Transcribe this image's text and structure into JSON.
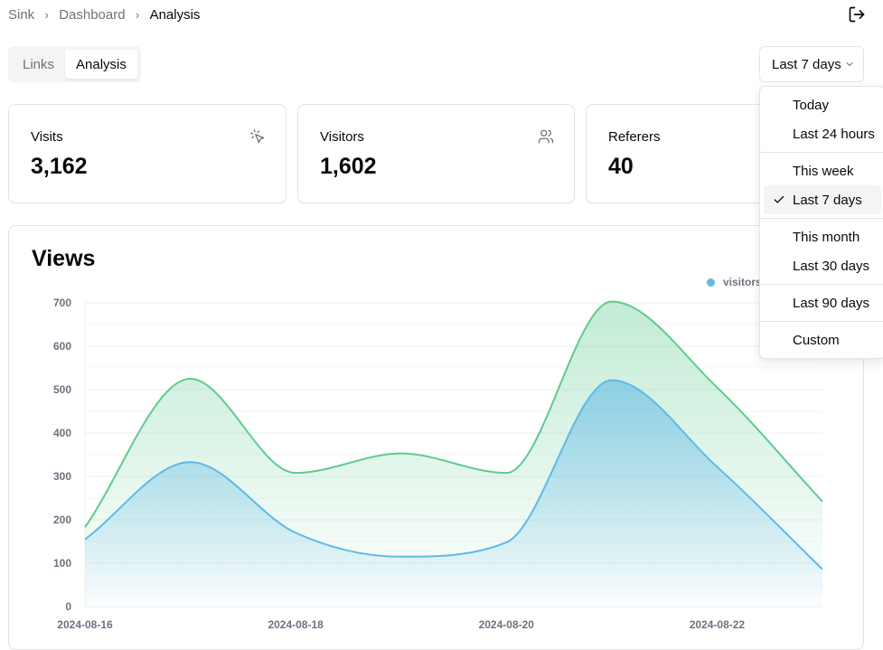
{
  "breadcrumb": [
    "Sink",
    "Dashboard",
    "Analysis"
  ],
  "icons": {
    "logout": "log-out-icon",
    "chevron": "chevron-down-icon",
    "check": "check-icon",
    "visits": "mouse-pointer-click-icon",
    "visitors": "users-icon"
  },
  "tabs": [
    {
      "label": "Links",
      "active": false
    },
    {
      "label": "Analysis",
      "active": true
    }
  ],
  "range": {
    "selected": "Last 7 days"
  },
  "stats": [
    {
      "label": "Visits",
      "value": "3,162"
    },
    {
      "label": "Visitors",
      "value": "1,602"
    },
    {
      "label": "Referers",
      "value": "40"
    }
  ],
  "views": {
    "title": "Views",
    "legend": [
      {
        "name": "visitors",
        "color": "#60b9e8"
      }
    ]
  },
  "dropdown": {
    "groups": [
      [
        {
          "label": "Today"
        },
        {
          "label": "Last 24 hours"
        }
      ],
      [
        {
          "label": "This week"
        },
        {
          "label": "Last 7 days",
          "selected": true
        }
      ],
      [
        {
          "label": "This month"
        },
        {
          "label": "Last 30 days"
        }
      ],
      [
        {
          "label": "Last 90 days"
        }
      ],
      [
        {
          "label": "Custom"
        }
      ]
    ]
  },
  "chart_data": {
    "type": "area",
    "x": [
      "2024-08-16",
      "2024-08-17",
      "2024-08-18",
      "2024-08-19",
      "2024-08-20",
      "2024-08-21",
      "2024-08-22",
      "2024-08-23"
    ],
    "x_tick_labels": [
      "2024-08-16",
      "2024-08-18",
      "2024-08-20",
      "2024-08-22"
    ],
    "ylim": [
      0,
      700
    ],
    "y_ticks": [
      0,
      100,
      200,
      300,
      400,
      500,
      600,
      700
    ],
    "grid": true,
    "legend_placement": "top-right",
    "series": [
      {
        "color": "#5ecb8f",
        "values": [
          183,
          525,
          308,
          353,
          308,
          703,
          505,
          242
        ]
      },
      {
        "name": "visitors",
        "color": "#60b9e8",
        "values": [
          155,
          333,
          170,
          115,
          148,
          522,
          322,
          86
        ]
      }
    ]
  }
}
